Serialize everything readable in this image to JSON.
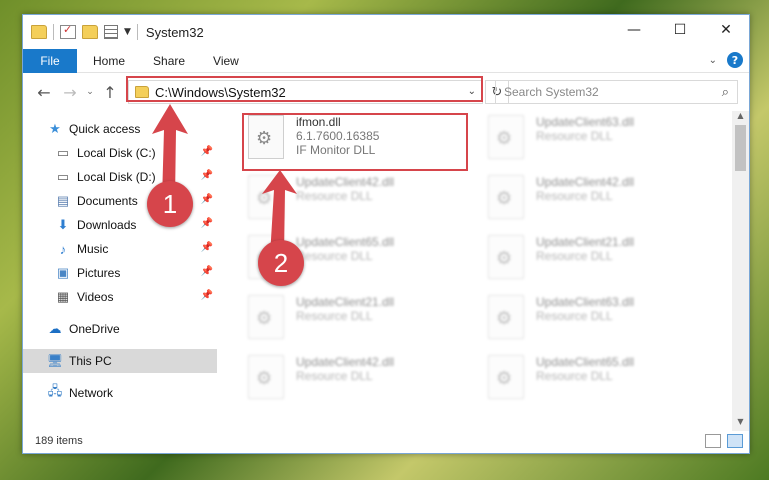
{
  "window": {
    "title": "System32",
    "controls": {
      "minimize": "—",
      "maximize": "☐",
      "close": "✕"
    }
  },
  "ribbon": {
    "tabs": [
      "File",
      "Home",
      "Share",
      "View"
    ]
  },
  "nav": {
    "back": "←",
    "forward": "→",
    "recent": "⌄",
    "up": "↑"
  },
  "address": {
    "path": "C:\\Windows\\System32"
  },
  "search": {
    "placeholder": "Search System32"
  },
  "sidebar": {
    "items": [
      {
        "label": "Quick access",
        "icon": "star-icon"
      },
      {
        "label": "Local Disk (C:)",
        "icon": "drive-icon"
      },
      {
        "label": "Local Disk (D:)",
        "icon": "drive-icon"
      },
      {
        "label": "Documents",
        "icon": "documents-icon"
      },
      {
        "label": "Downloads",
        "icon": "download-icon"
      },
      {
        "label": "Music",
        "icon": "music-icon"
      },
      {
        "label": "Pictures",
        "icon": "pictures-icon"
      },
      {
        "label": "Videos",
        "icon": "videos-icon"
      },
      {
        "label": "OneDrive",
        "icon": "cloud-icon"
      },
      {
        "label": "This PC",
        "icon": "computer-icon"
      },
      {
        "label": "Network",
        "icon": "network-icon"
      }
    ]
  },
  "files": [
    {
      "name": "ifmon.dll",
      "version": "6.1.7600.16385",
      "desc": "IF Monitor DLL"
    },
    {
      "name": "UpdateClient63.dll",
      "desc": "Resource DLL"
    },
    {
      "name": "UpdateClient42.dll",
      "desc": "Resource DLL"
    },
    {
      "name": "UpdateClient42.dll",
      "desc": "Resource DLL"
    },
    {
      "name": "UpdateClient65.dll",
      "desc": "Resource DLL"
    },
    {
      "name": "UpdateClient21.dll",
      "desc": "Resource DLL"
    },
    {
      "name": "UpdateClient21.dll",
      "desc": "Resource DLL"
    },
    {
      "name": "UpdateClient63.dll",
      "desc": "Resource DLL"
    },
    {
      "name": "UpdateClient42.dll",
      "desc": "Resource DLL"
    },
    {
      "name": "UpdateClient65.dll",
      "desc": "Resource DLL"
    }
  ],
  "status": {
    "count": "189 items"
  },
  "callouts": [
    "1",
    "2"
  ],
  "colors": {
    "accent": "#1979ca",
    "annotation": "#d6454b"
  }
}
